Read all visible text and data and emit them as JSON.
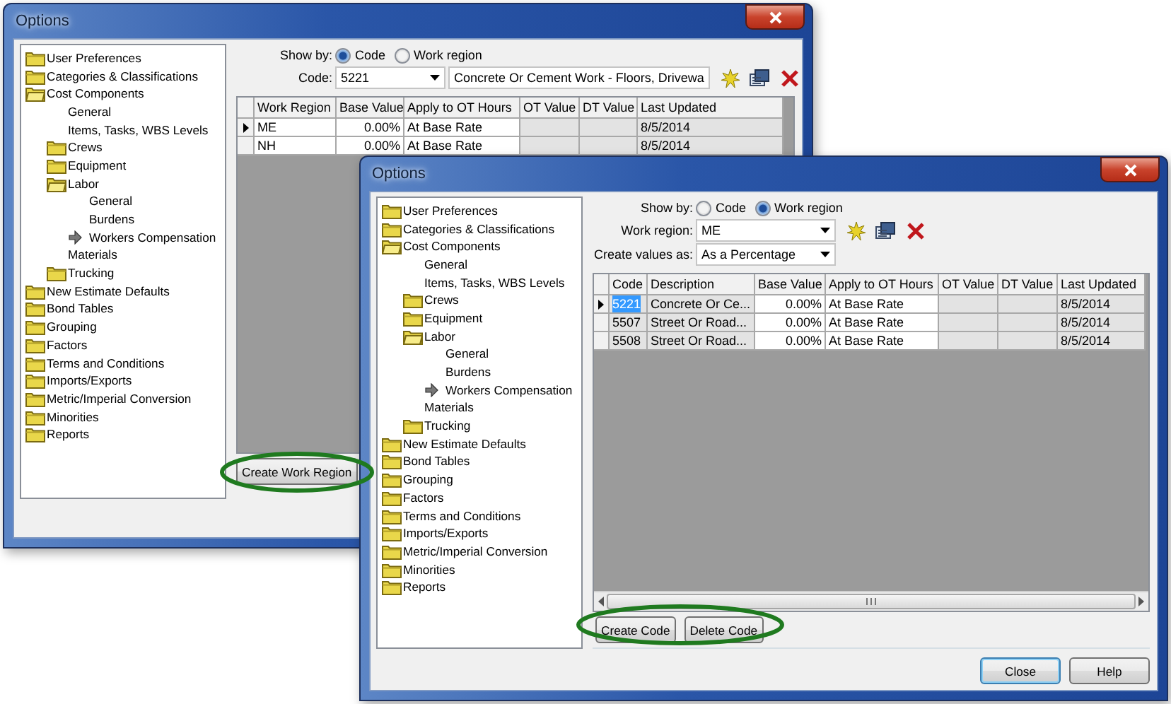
{
  "windows": [
    {
      "title": "Options",
      "tree": [
        {
          "label": "User Preferences",
          "kind": "folder",
          "expanded": false
        },
        {
          "label": "Categories & Classifications",
          "kind": "folder",
          "expanded": false
        },
        {
          "label": "Cost Components",
          "kind": "folder",
          "expanded": true,
          "children": [
            {
              "label": "General",
              "kind": "leaf"
            },
            {
              "label": "Items, Tasks, WBS Levels",
              "kind": "leaf"
            },
            {
              "label": "Crews",
              "kind": "folder",
              "expanded": false
            },
            {
              "label": "Equipment",
              "kind": "folder",
              "expanded": false
            },
            {
              "label": "Labor",
              "kind": "folder",
              "expanded": true,
              "children": [
                {
                  "label": "General",
                  "kind": "leaf"
                },
                {
                  "label": "Burdens",
                  "kind": "leaf"
                },
                {
                  "label": "Workers Compensation",
                  "kind": "pointer"
                }
              ]
            },
            {
              "label": "Materials",
              "kind": "leaf"
            },
            {
              "label": "Trucking",
              "kind": "folder",
              "expanded": false
            }
          ]
        },
        {
          "label": "New Estimate Defaults",
          "kind": "folder",
          "expanded": false
        },
        {
          "label": "Bond Tables",
          "kind": "folder",
          "expanded": false
        },
        {
          "label": "Grouping",
          "kind": "folder",
          "expanded": false
        },
        {
          "label": "Factors",
          "kind": "folder",
          "expanded": false
        },
        {
          "label": "Terms and Conditions",
          "kind": "folder",
          "expanded": false
        },
        {
          "label": "Imports/Exports",
          "kind": "folder",
          "expanded": false
        },
        {
          "label": "Metric/Imperial Conversion",
          "kind": "folder",
          "expanded": false
        },
        {
          "label": "Minorities",
          "kind": "folder",
          "expanded": false
        },
        {
          "label": "Reports",
          "kind": "folder",
          "expanded": false
        }
      ],
      "show_by": {
        "label": "Show by:",
        "options": [
          {
            "label": "Code",
            "selected": true
          },
          {
            "label": "Work region",
            "selected": false
          }
        ]
      },
      "fields": [
        {
          "label": "Code:",
          "tools": true,
          "combos": [
            "5221",
            "Concrete Or Cement Work - Floors, Drivewa"
          ]
        }
      ],
      "grid": {
        "scrollbar": false,
        "columns": [
          {
            "label": "Work Region",
            "kind": "text",
            "editable": true
          },
          {
            "label": "Base Value",
            "kind": "number",
            "editable": true
          },
          {
            "label": "Apply to OT Hours",
            "kind": "text",
            "editable": true
          },
          {
            "label": "OT Value",
            "kind": "number",
            "editable": false
          },
          {
            "label": "DT Value",
            "kind": "number",
            "editable": false
          },
          {
            "label": "Last Updated",
            "kind": "text",
            "editable": false
          }
        ],
        "rows": [
          {
            "selected": true,
            "first_cell_highlighted": false,
            "cells": [
              "ME",
              "0.00%",
              "At Base Rate",
              null,
              null,
              "8/5/2014"
            ]
          },
          {
            "selected": false,
            "first_cell_highlighted": false,
            "cells": [
              "NH",
              "0.00%",
              "At Base Rate",
              null,
              null,
              "8/5/2014"
            ]
          }
        ]
      },
      "buttons": [
        "Create Work Region"
      ]
    },
    {
      "title": "Options",
      "tree": [
        {
          "label": "User Preferences",
          "kind": "folder",
          "expanded": false
        },
        {
          "label": "Categories & Classifications",
          "kind": "folder",
          "expanded": false
        },
        {
          "label": "Cost Components",
          "kind": "folder",
          "expanded": true,
          "children": [
            {
              "label": "General",
              "kind": "leaf"
            },
            {
              "label": "Items, Tasks, WBS Levels",
              "kind": "leaf"
            },
            {
              "label": "Crews",
              "kind": "folder",
              "expanded": false
            },
            {
              "label": "Equipment",
              "kind": "folder",
              "expanded": false
            },
            {
              "label": "Labor",
              "kind": "folder",
              "expanded": true,
              "children": [
                {
                  "label": "General",
                  "kind": "leaf"
                },
                {
                  "label": "Burdens",
                  "kind": "leaf"
                },
                {
                  "label": "Workers Compensation",
                  "kind": "pointer"
                }
              ]
            },
            {
              "label": "Materials",
              "kind": "leaf"
            },
            {
              "label": "Trucking",
              "kind": "folder",
              "expanded": false
            }
          ]
        },
        {
          "label": "New Estimate Defaults",
          "kind": "folder",
          "expanded": false
        },
        {
          "label": "Bond Tables",
          "kind": "folder",
          "expanded": false
        },
        {
          "label": "Grouping",
          "kind": "folder",
          "expanded": false
        },
        {
          "label": "Factors",
          "kind": "folder",
          "expanded": false
        },
        {
          "label": "Terms and Conditions",
          "kind": "folder",
          "expanded": false
        },
        {
          "label": "Imports/Exports",
          "kind": "folder",
          "expanded": false
        },
        {
          "label": "Metric/Imperial Conversion",
          "kind": "folder",
          "expanded": false
        },
        {
          "label": "Minorities",
          "kind": "folder",
          "expanded": false
        },
        {
          "label": "Reports",
          "kind": "folder",
          "expanded": false
        }
      ],
      "show_by": {
        "label": "Show by:",
        "options": [
          {
            "label": "Code",
            "selected": false
          },
          {
            "label": "Work region",
            "selected": true
          }
        ]
      },
      "fields": [
        {
          "label": "Work region:",
          "tools": true,
          "combos": [
            "ME"
          ]
        },
        {
          "label": "Create values as:",
          "tools": false,
          "combos": [
            "As a Percentage"
          ]
        }
      ],
      "grid": {
        "scrollbar": true,
        "columns": [
          {
            "label": "Code",
            "kind": "text",
            "editable": false
          },
          {
            "label": "Description",
            "kind": "text",
            "editable": false
          },
          {
            "label": "Base Value",
            "kind": "number",
            "editable": true
          },
          {
            "label": "Apply to OT Hours",
            "kind": "text",
            "editable": true
          },
          {
            "label": "OT Value",
            "kind": "number",
            "editable": false
          },
          {
            "label": "DT Value",
            "kind": "number",
            "editable": false
          },
          {
            "label": "Last Updated",
            "kind": "text",
            "editable": false
          }
        ],
        "rows": [
          {
            "selected": true,
            "first_cell_highlighted": true,
            "cells": [
              "5221",
              "Concrete Or Ce...",
              "0.00%",
              "At Base Rate",
              null,
              null,
              "8/5/2014"
            ]
          },
          {
            "selected": false,
            "first_cell_highlighted": false,
            "cells": [
              "5507",
              "Street Or Road...",
              "0.00%",
              "At Base Rate",
              null,
              null,
              "8/5/2014"
            ]
          },
          {
            "selected": false,
            "first_cell_highlighted": false,
            "cells": [
              "5508",
              "Street Or Road...",
              "0.00%",
              "At Base Rate",
              null,
              null,
              "8/5/2014"
            ]
          }
        ]
      },
      "buttons": [
        "Create Code",
        "Delete Code"
      ],
      "footer_buttons": [
        {
          "label": "Close",
          "default": true
        },
        {
          "label": "Help",
          "default": false
        }
      ]
    }
  ]
}
